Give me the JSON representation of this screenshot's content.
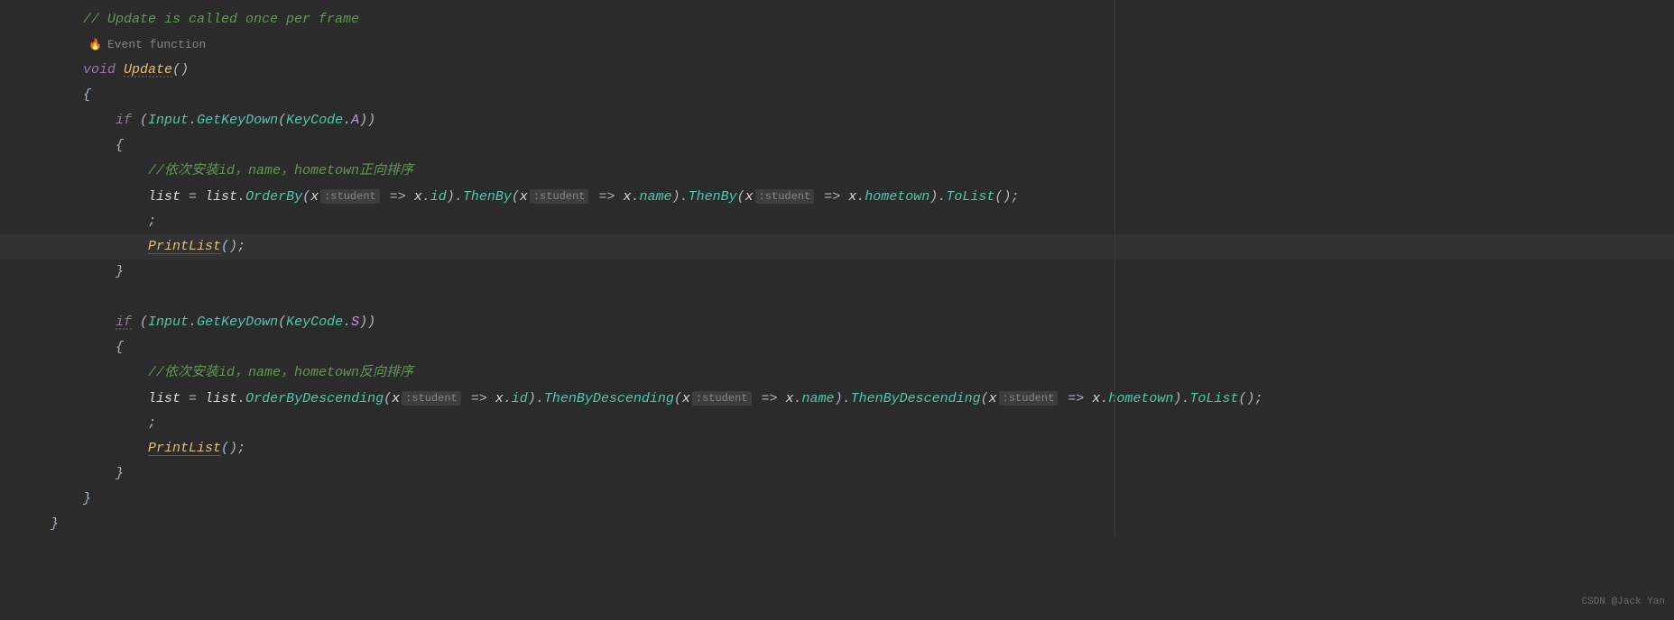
{
  "header_comment": "// Update is called once per frame",
  "hint": {
    "icon": "🔥",
    "label": "Event function"
  },
  "sig": {
    "kw_void": "void",
    "name": "Update",
    "parens": "()"
  },
  "braces": {
    "open": "{",
    "close": "}"
  },
  "if1": {
    "kw_if": "if",
    "open": " (",
    "input": "Input",
    "dot1": ".",
    "getkeydown": "GetKeyDown",
    "openp": "(",
    "keycode": "KeyCode",
    "dot2": ".",
    "key": "A",
    "closep": "))"
  },
  "comment1": "//依次安装id，name，hometown正向排序",
  "line1": {
    "lhs": "list",
    "eq": " = ",
    "rhs_list": "list",
    "dot": ".",
    "orderby": "OrderBy",
    "open": "(",
    "x1": "x",
    "hint": ":student",
    "arrow": " => ",
    "x1b": "x",
    "dot2": ".",
    "id": "id",
    "close": ")",
    "dot3": ".",
    "thenby": "ThenBy",
    "open2": "(",
    "x2": "x",
    "arrow2": " => ",
    "x2b": "x",
    "dot4": ".",
    "name": "name",
    "close2": ")",
    "dot5": ".",
    "thenby2": "ThenBy",
    "open3": "(",
    "x3": "x",
    "arrow3": " => ",
    "x3b": "x",
    "dot6": ".",
    "hometown": "hometown",
    "close3": ")",
    "dot7": ".",
    "tolist": "ToList",
    "end": "();"
  },
  "semicolon_only": ";",
  "printlist": {
    "name": "PrintList",
    "call": "();"
  },
  "if2": {
    "kw_if": "if",
    "open": " (",
    "input": "Input",
    "dot1": ".",
    "getkeydown": "GetKeyDown",
    "openp": "(",
    "keycode": "KeyCode",
    "dot2": ".",
    "key": "S",
    "closep": "))"
  },
  "comment2": "//依次安装id，name，hometown反向排序",
  "line2": {
    "lhs": "list",
    "eq": " = ",
    "rhs_list": "list",
    "dot": ".",
    "orderby": "OrderByDescending",
    "open": "(",
    "x1": "x",
    "hint": ":student",
    "arrow": " => ",
    "x1b": "x",
    "dot2": ".",
    "id": "id",
    "close": ")",
    "dot3": ".",
    "thenby": "ThenByDescending",
    "open2": "(",
    "x2": "x",
    "arrow2": " => ",
    "x2b": "x",
    "dot4": ".",
    "name": "name",
    "close2": ")",
    "dot5": ".",
    "thenby2": "ThenByDescending",
    "open3": "(",
    "x3": "x",
    "arrow3": " => ",
    "x3b": "x",
    "dot6": ".",
    "hometown": "hometown",
    "close3": ")",
    "dot7": ".",
    "tolist": "ToList",
    "end": "();"
  },
  "watermark": "CSDN @Jack Yan"
}
